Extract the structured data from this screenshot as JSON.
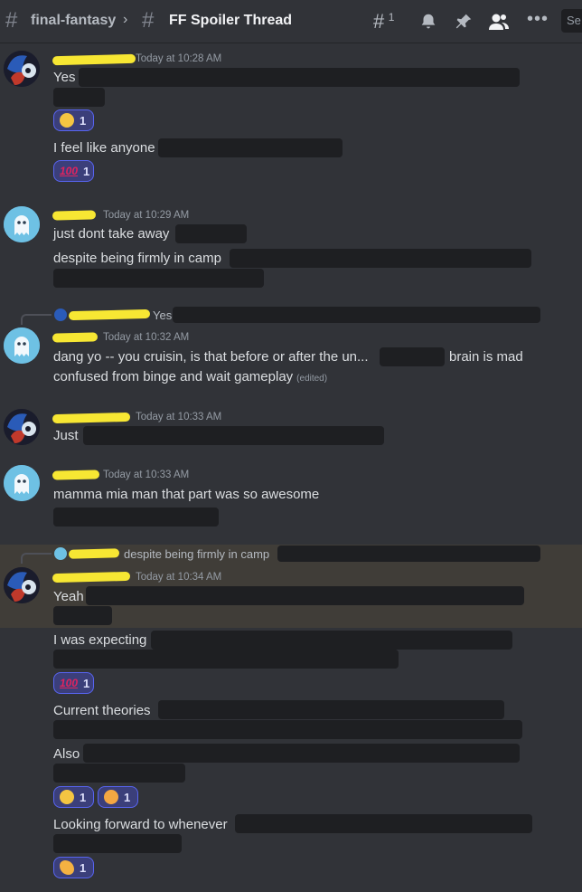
{
  "header": {
    "channel": "final-fantasy",
    "thread": "FF Spoiler Thread",
    "threads_count": "1",
    "search_placeholder": "Se"
  },
  "messages": {
    "m1": {
      "time": "Today at 10:28 AM",
      "line1": "Yes",
      "r1": "1",
      "line2": "I feel like anyone",
      "r2": "1"
    },
    "m2": {
      "time": "Today at 10:29 AM",
      "line1": "just dont take away",
      "line2": "despite being firmly in camp"
    },
    "m3": {
      "reply": "Yes",
      "time": "Today at 10:32 AM",
      "line1a": "dang yo -- you cruisin, is that before or after the un...",
      "line1b": "brain is mad",
      "line2": "confused from binge and wait gameplay",
      "edited": "(edited)"
    },
    "m4": {
      "time": "Today at 10:33 AM",
      "line1": "Just"
    },
    "m5": {
      "time": "Today at 10:33 AM",
      "line1": "mamma mia man that part was so awesome"
    },
    "m6": {
      "reply": "despite being firmly in camp",
      "time": "Today at 10:34 AM",
      "line1": "Yeah",
      "line2": "I was expecting",
      "r1": "1",
      "line3": "Current theories",
      "line4": "Also",
      "r2a": "1",
      "r2b": "1",
      "line5": "Looking forward to whenever",
      "r3": "1"
    }
  },
  "emoji": {
    "hundred": "100"
  }
}
